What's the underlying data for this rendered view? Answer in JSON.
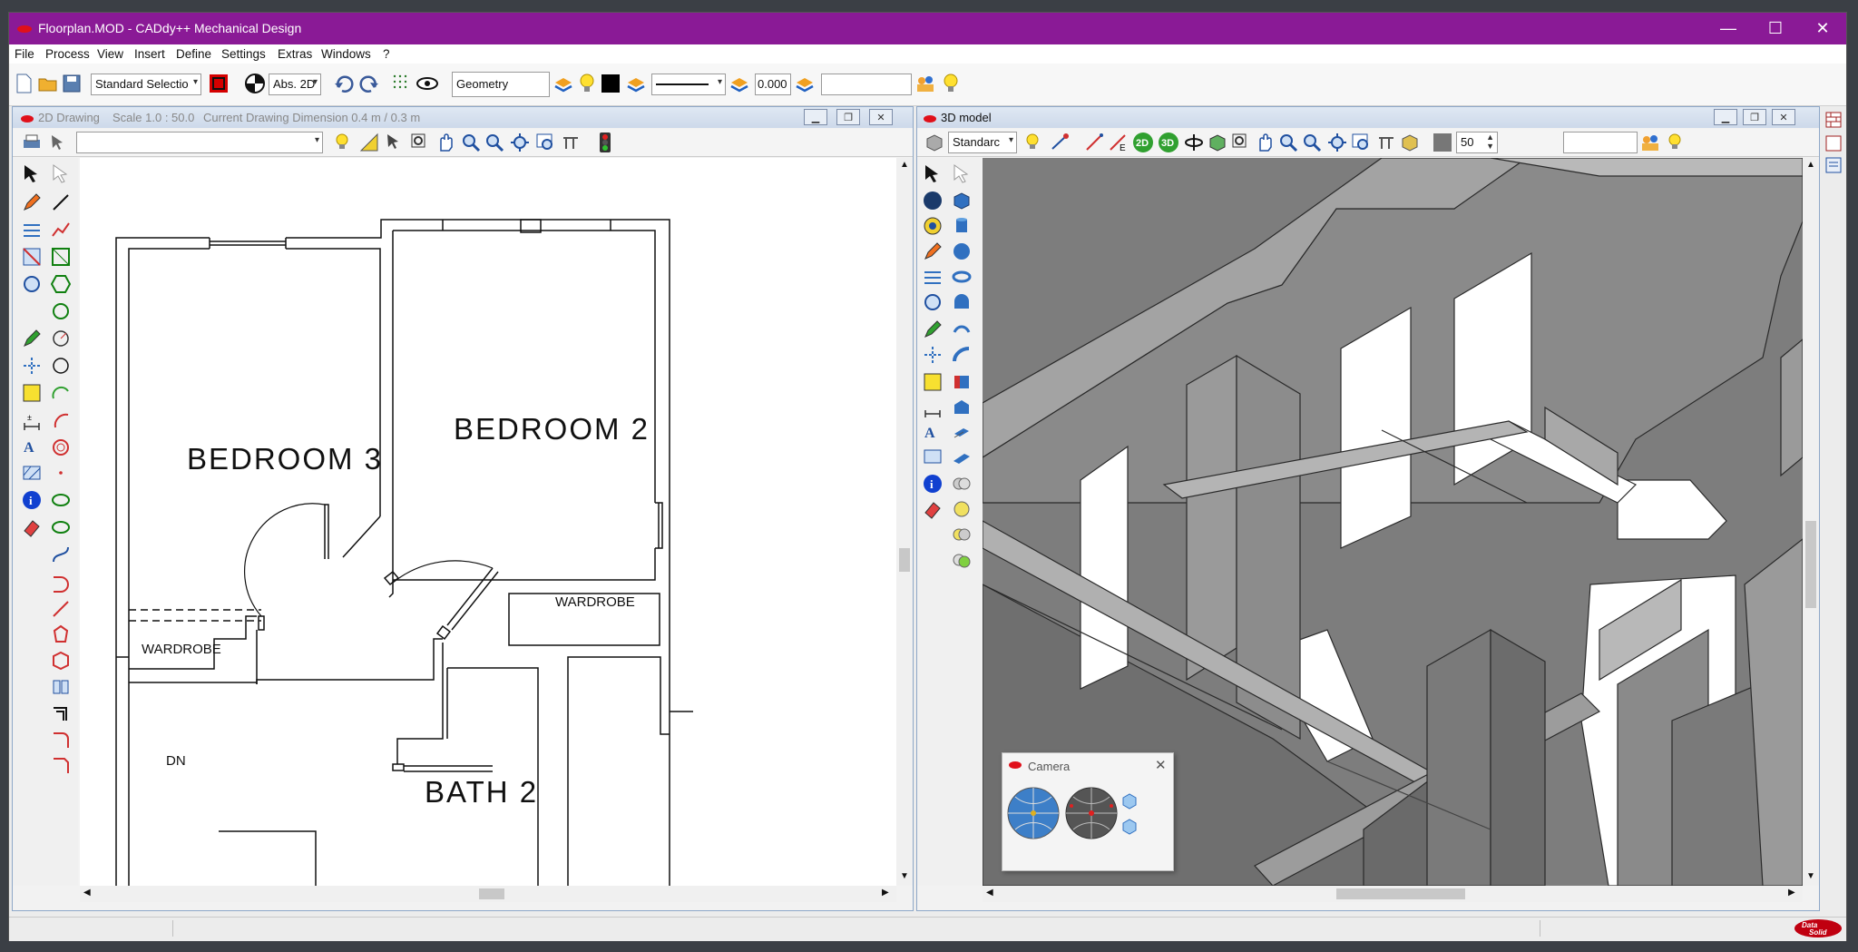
{
  "window": {
    "title": "Floorplan.MOD  -  CADdy++ Mechanical Design",
    "minimize": "—",
    "maximize": "☐",
    "close": "✕"
  },
  "menu": [
    "File",
    "Process",
    "View",
    "Insert",
    "Define",
    "Settings",
    "Extras",
    "Windows",
    "?"
  ],
  "toolbar": {
    "selection_mode": "Standard Selectio",
    "coord_mode": "Abs. 2D",
    "layer_name": "Geometry",
    "line_width": "0.000",
    "extra_field": ""
  },
  "drawing2d": {
    "title": "2D Drawing",
    "scale": "Scale 1.0 : 50.0",
    "dimension": "Current Drawing Dimension 0.4 m / 0.3 m",
    "command_field": "",
    "labels": {
      "bedroom3": "BEDROOM 3",
      "bedroom2": "BEDROOM 2",
      "wardrobe1": "WARDROBE",
      "wardrobe2": "WARDROBE",
      "dn": "DN",
      "bath2": "BATH 2"
    }
  },
  "model3d": {
    "title": "3D model",
    "view_preset": "Standarc",
    "btn_2d": "2D",
    "btn_3d": "3D",
    "zoom_value": "50",
    "extra_field": ""
  },
  "camera": {
    "title": "Camera",
    "close": "✕"
  },
  "colors": {
    "titlebar": "#8a1a96",
    "accent_red": "#d40000"
  }
}
